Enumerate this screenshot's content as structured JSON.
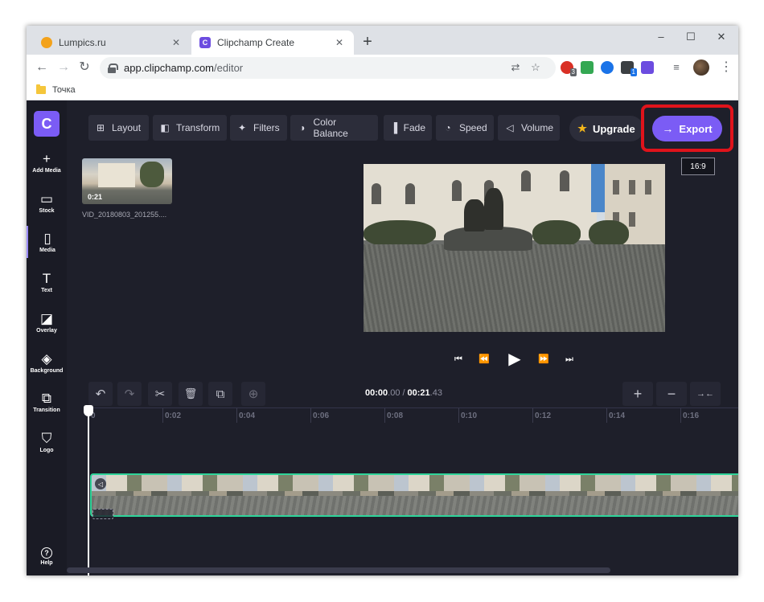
{
  "browser": {
    "tabs": [
      {
        "title": "Lumpics.ru",
        "active": false
      },
      {
        "title": "Clipchamp Create",
        "active": true
      }
    ],
    "favicon_cc": "C",
    "new_tab_label": "+",
    "window_controls": {
      "minimize": "–",
      "maximize": "☐",
      "close": "✕"
    },
    "nav": {
      "back": "←",
      "forward": "→",
      "reload": "↻"
    },
    "url": {
      "host": "app.clipchamp.com",
      "path": "/editor"
    },
    "extension_badges": {
      "first": "3",
      "second": "1"
    },
    "bookmark": "Точка"
  },
  "app": {
    "logo": "C",
    "sidebar": [
      {
        "icon": "plus-icon",
        "glyph": "+",
        "label": "Add Media"
      },
      {
        "icon": "stock-icon",
        "glyph": "▭",
        "label": "Stock"
      },
      {
        "icon": "media-icon",
        "glyph": "▯",
        "label": "Media",
        "active": true
      },
      {
        "icon": "text-icon",
        "glyph": "T",
        "label": "Text"
      },
      {
        "icon": "overlay-icon",
        "glyph": "◪",
        "label": "Overlay"
      },
      {
        "icon": "background-icon",
        "glyph": "◈",
        "label": "Background"
      },
      {
        "icon": "transition-icon",
        "glyph": "⧉",
        "label": "Transition"
      },
      {
        "icon": "logo-shield-icon",
        "glyph": "⛉",
        "label": "Logo"
      }
    ],
    "help": {
      "glyph": "?",
      "label": "Help"
    },
    "effects": [
      {
        "icon": "layout-icon",
        "glyph": "⊞",
        "label": "Layout"
      },
      {
        "icon": "transform-icon",
        "glyph": "◧",
        "label": "Transform"
      },
      {
        "icon": "filters-icon",
        "glyph": "✦",
        "label": "Filters"
      },
      {
        "icon": "color-balance-icon",
        "glyph": "◑",
        "label": "Color Balance"
      },
      {
        "icon": "fade-icon",
        "glyph": "▐",
        "label": "Fade"
      },
      {
        "icon": "speed-icon",
        "glyph": "◔",
        "label": "Speed"
      },
      {
        "icon": "volume-icon",
        "glyph": "◁",
        "label": "Volume"
      }
    ],
    "upgrade_label": "Upgrade",
    "export_label": "Export",
    "aspect_ratio": "16:9",
    "media": {
      "duration": "0:21",
      "filename": "VID_20180803_201255...."
    },
    "player": {
      "skip_back": "⏮",
      "rewind": "⏪",
      "play": "▶",
      "forward": "⏩",
      "skip_forward": "⏭"
    },
    "timeline": {
      "current_main": "00:00",
      "current_ms": ".00",
      "separator": "/",
      "total_main": "00:21",
      "total_ms": ".43",
      "ticks": [
        "0",
        "0:02",
        "0:04",
        "0:06",
        "0:08",
        "0:10",
        "0:12",
        "0:14",
        "0:16"
      ],
      "tools": {
        "undo": "↶",
        "redo": "↷",
        "split": "✂",
        "delete": "🗑",
        "duplicate": "⧉",
        "copy": "⊕",
        "zoom_in": "+",
        "zoom_out": "−",
        "fit": "→←"
      }
    },
    "accent": "#7b5cf5",
    "highlight": "#e0131b",
    "track_border": "#2fd49a"
  }
}
